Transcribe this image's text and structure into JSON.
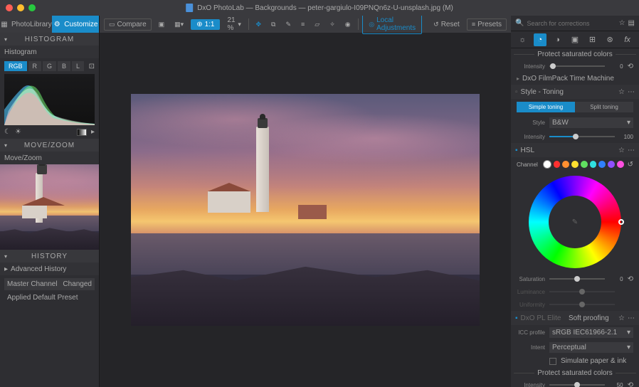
{
  "titlebar": {
    "title": "DxO PhotoLab — Backgrounds — peter-gargiulo-I09PNQn6z-U-unsplash.jpg (M)"
  },
  "tabs": {
    "library": "PhotoLibrary",
    "customize": "Customize"
  },
  "toolbar": {
    "compare": "Compare",
    "fit_ratio": "1:1",
    "zoom": "21 %",
    "local": "Local Adjustments",
    "reset": "Reset",
    "presets": "Presets"
  },
  "left": {
    "histogram_hdr": "HISTOGRAM",
    "histogram_sub": "Histogram",
    "modes": [
      "RGB",
      "R",
      "G",
      "B",
      "L"
    ],
    "movezoom_hdr": "MOVE/ZOOM",
    "movezoom_sub": "Move/Zoom",
    "history_hdr": "HISTORY",
    "history_sub": "Advanced History",
    "history_items": [
      {
        "label": "Master Channel",
        "status": "Changed"
      },
      {
        "label": "Applied Default Preset",
        "status": ""
      }
    ]
  },
  "right": {
    "search_placeholder": "Search for corrections",
    "protect_hdr": "Protect saturated colors",
    "intensity_lbl": "Intensity",
    "intensity_val1": "0",
    "filmpack": "DxO FilmPack Time Machine",
    "style_toning_hdr": "Style - Toning",
    "simple_toning": "Simple toning",
    "split_toning": "Split toning",
    "style_lbl": "Style",
    "style_val": "B&W",
    "style_intensity_val": "100",
    "hsl_hdr": "HSL",
    "channel_lbl": "Channel",
    "channel_colors": [
      "#ffffff",
      "#ff3030",
      "#ff9030",
      "#ffe030",
      "#60e060",
      "#30e0e0",
      "#3080ff",
      "#9050ff",
      "#ff50e0"
    ],
    "saturation_lbl": "Saturation",
    "saturation_val": "0",
    "luminance_lbl": "Luminance",
    "uniformity_lbl": "Uniformity",
    "softproof_hdr": "Soft proofing",
    "softproof_prefix": "DxO PL Elite",
    "icc_lbl": "ICC profile",
    "icc_val": "sRGB IEC61966-2.1",
    "intent_lbl": "Intent",
    "intent_val": "Perceptual",
    "simulate": "Simulate paper & ink",
    "intensity_val2": "50"
  }
}
